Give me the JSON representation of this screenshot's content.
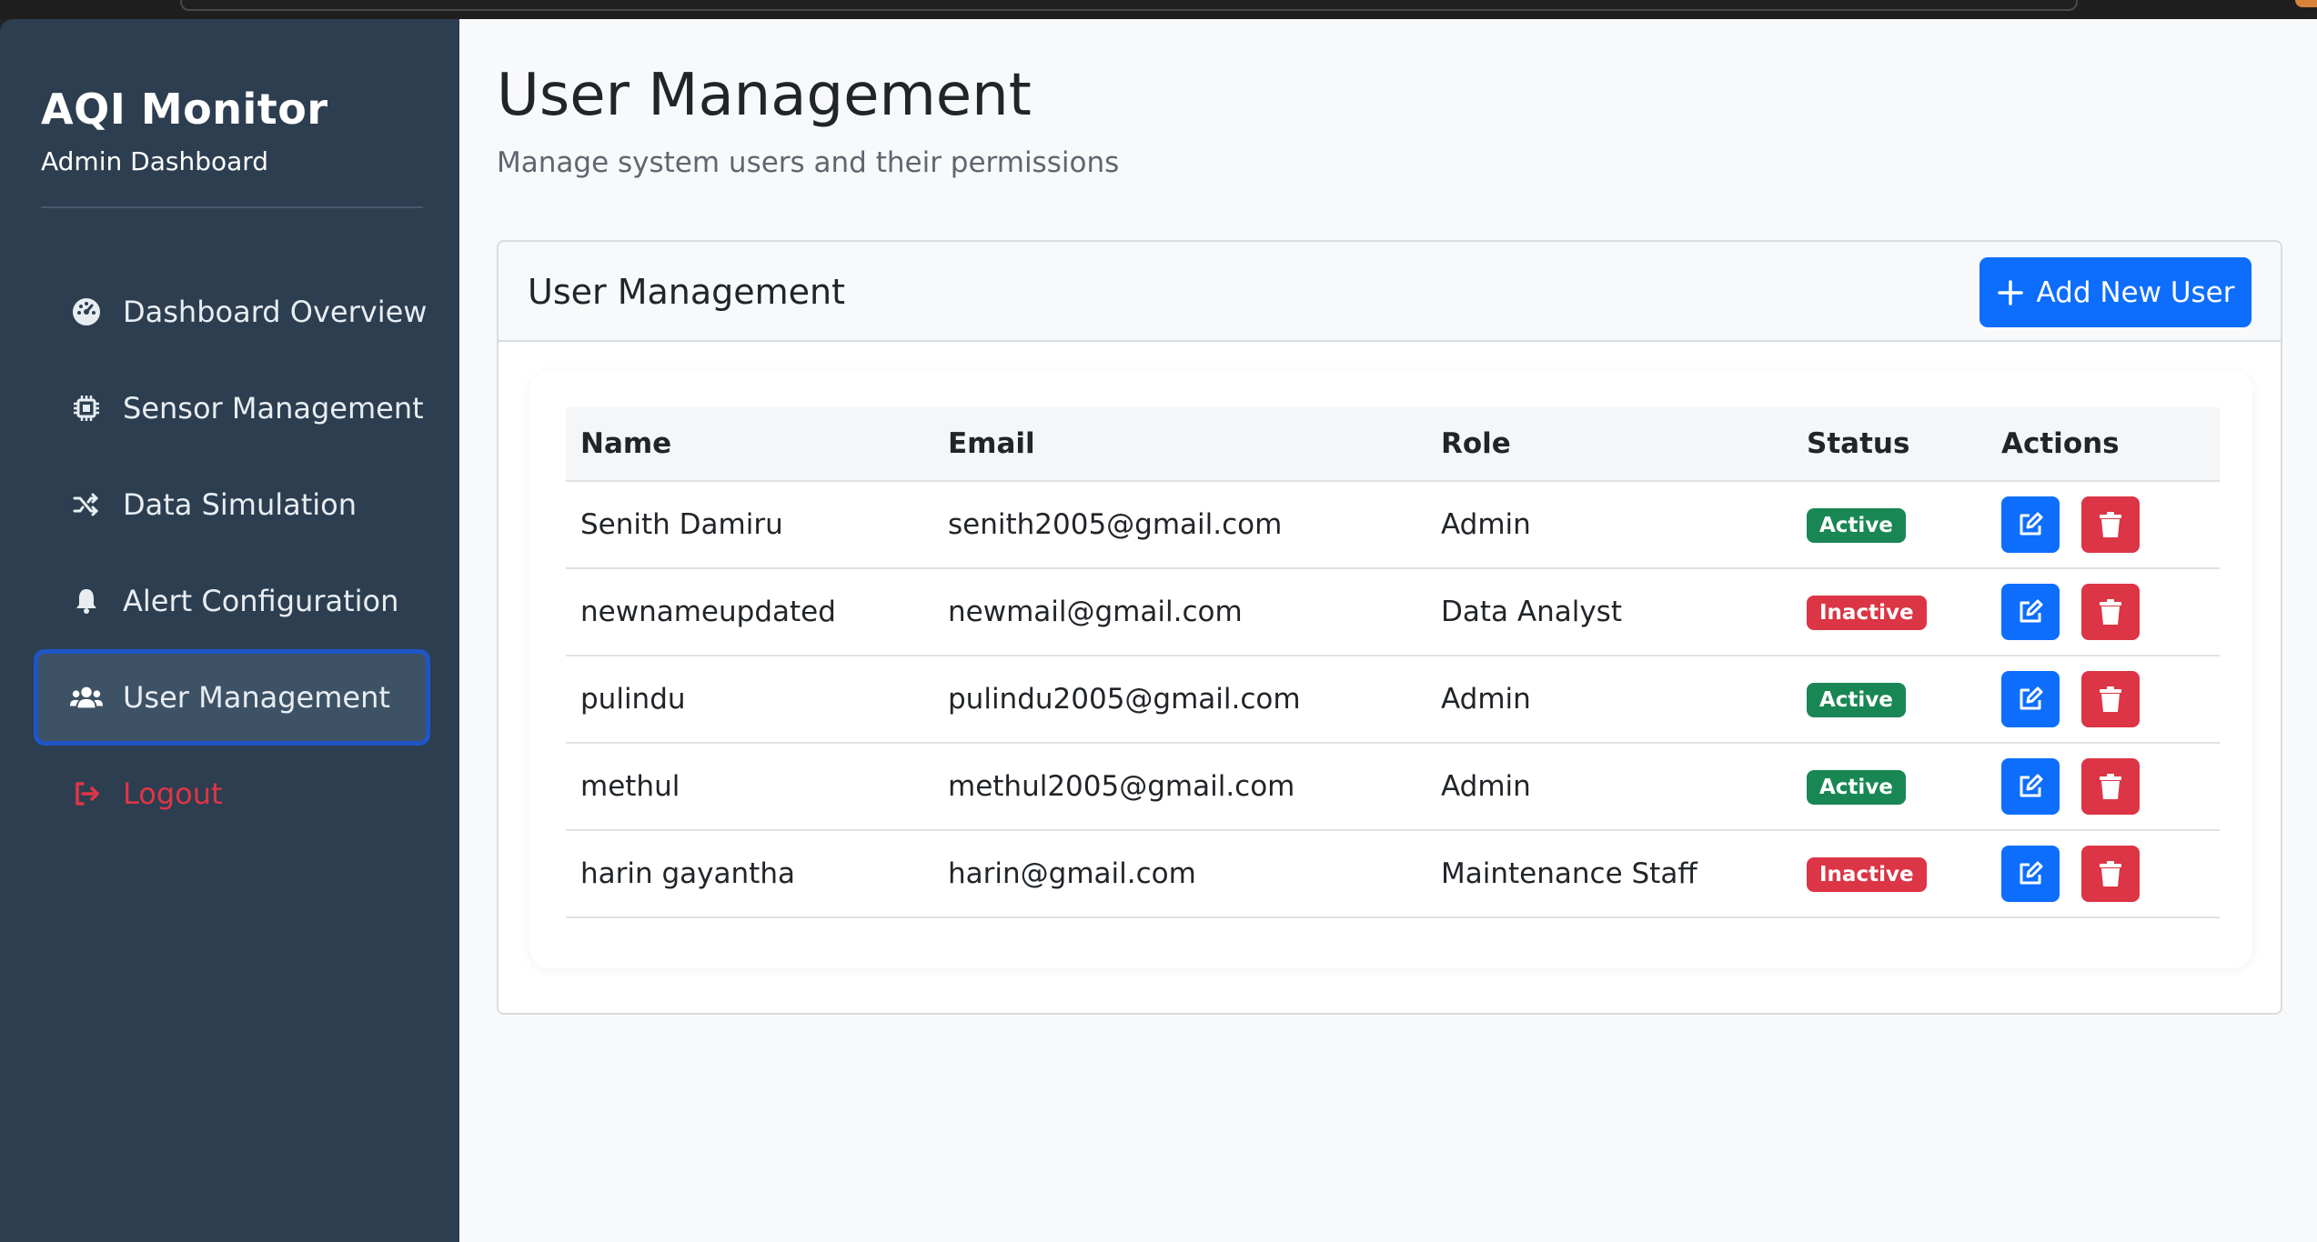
{
  "colors": {
    "sidebar_bg": "#2c3e50",
    "primary": "#0d6efd",
    "danger": "#dc3545",
    "success": "#198754",
    "logout": "#e03545"
  },
  "sidebar": {
    "title": "AQI Monitor",
    "subtitle": "Admin Dashboard",
    "items": [
      {
        "label": "Dashboard Overview",
        "icon": "tachometer-icon",
        "active": false
      },
      {
        "label": "Sensor Management",
        "icon": "chip-icon",
        "active": false
      },
      {
        "label": "Data Simulation",
        "icon": "shuffle-icon",
        "active": false
      },
      {
        "label": "Alert Configuration",
        "icon": "bell-icon",
        "active": false
      },
      {
        "label": "User Management",
        "icon": "users-icon",
        "active": true
      },
      {
        "label": "Logout",
        "icon": "logout-icon",
        "active": false
      }
    ]
  },
  "main": {
    "title": "User Management",
    "subtitle": "Manage system users and their permissions",
    "card": {
      "title": "User Management",
      "add_button": "Add New User"
    },
    "table": {
      "headers": [
        "Name",
        "Email",
        "Role",
        "Status",
        "Actions"
      ],
      "rows": [
        {
          "name": "Senith Damiru",
          "email": "senith2005@gmail.com",
          "role": "Admin",
          "status": "Active"
        },
        {
          "name": "newnameupdated",
          "email": "newmail@gmail.com",
          "role": "Data Analyst",
          "status": "Inactive"
        },
        {
          "name": "pulindu",
          "email": "pulindu2005@gmail.com",
          "role": "Admin",
          "status": "Active"
        },
        {
          "name": "methul",
          "email": "methul2005@gmail.com",
          "role": "Admin",
          "status": "Active"
        },
        {
          "name": "harin gayantha",
          "email": "harin@gmail.com",
          "role": "Maintenance Staff",
          "status": "Inactive"
        }
      ]
    }
  }
}
